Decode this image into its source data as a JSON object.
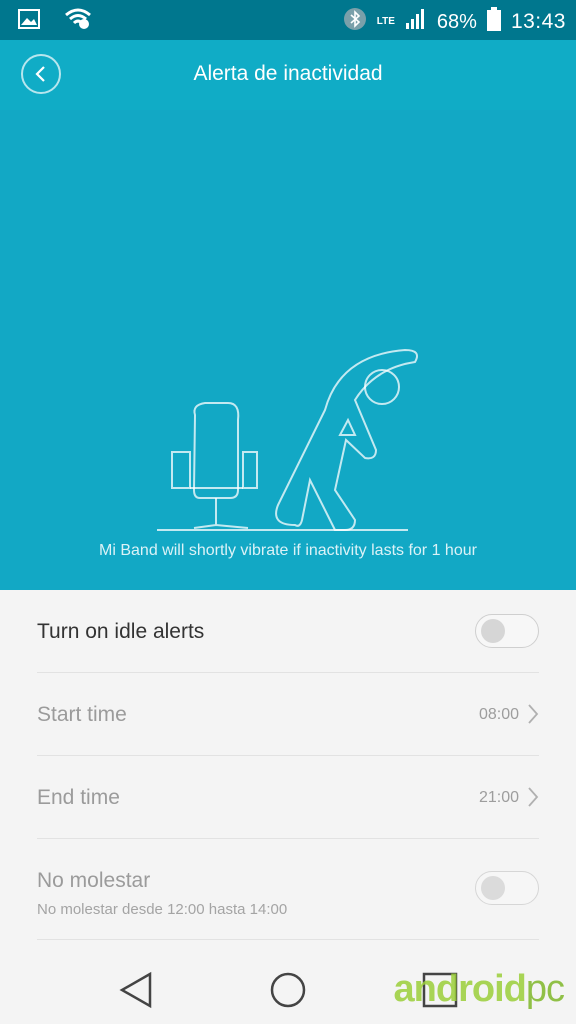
{
  "status_bar": {
    "battery": "68%",
    "time": "13:43",
    "network": "LTE",
    "icons": [
      "gallery-icon",
      "wifi-icon",
      "bluetooth-icon",
      "lte-icon",
      "signal-icon",
      "battery-icon"
    ]
  },
  "header": {
    "title": "Alerta de inactividad",
    "back_icon": "back-icon"
  },
  "hero": {
    "description": "Mi Band will shortly vibrate if inactivity lasts for 1 hour",
    "illustration": "chair-stretch-illustration",
    "bg_color": "#12a8c5"
  },
  "settings": {
    "idle_alerts": {
      "label": "Turn on idle alerts",
      "enabled": false
    },
    "start_time": {
      "label": "Start time",
      "value": "08:00"
    },
    "end_time": {
      "label": "End time",
      "value": "21:00"
    },
    "do_not_disturb": {
      "label": "No molestar",
      "sublabel": "No molestar desde 12:00 hasta 14:00",
      "enabled": false
    }
  },
  "navbar": {
    "buttons": [
      "back-nav-icon",
      "home-nav-icon",
      "recents-nav-icon"
    ]
  },
  "watermark": {
    "part1": "android",
    "part2": "pc"
  }
}
